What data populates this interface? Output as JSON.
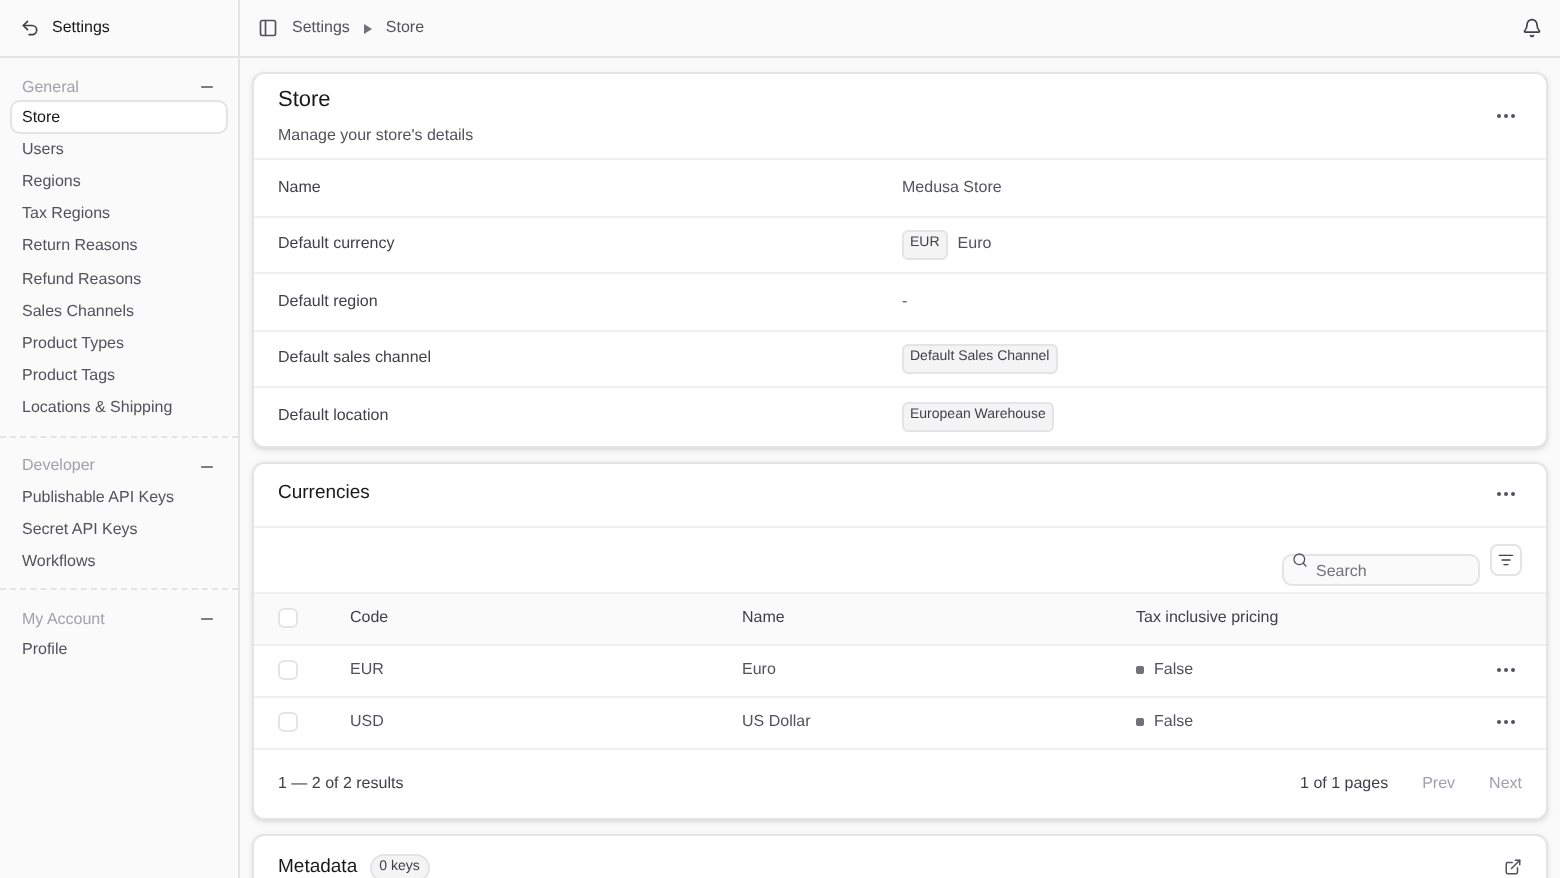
{
  "sidebar": {
    "title": "Settings",
    "sections": [
      {
        "label": "General",
        "expanded": true,
        "items": [
          {
            "label": "Store",
            "selected": true
          },
          {
            "label": "Users",
            "selected": false
          },
          {
            "label": "Regions",
            "selected": false
          },
          {
            "label": "Tax Regions",
            "selected": false
          },
          {
            "label": "Return Reasons",
            "selected": false
          },
          {
            "label": "Refund Reasons",
            "selected": false
          },
          {
            "label": "Sales Channels",
            "selected": false
          },
          {
            "label": "Product Types",
            "selected": false
          },
          {
            "label": "Product Tags",
            "selected": false
          },
          {
            "label": "Locations & Shipping",
            "selected": false
          }
        ]
      },
      {
        "label": "Developer",
        "expanded": true,
        "items": [
          {
            "label": "Publishable API Keys",
            "selected": false
          },
          {
            "label": "Secret API Keys",
            "selected": false
          },
          {
            "label": "Workflows",
            "selected": false
          }
        ]
      },
      {
        "label": "My Account",
        "expanded": true,
        "items": [
          {
            "label": "Profile",
            "selected": false
          }
        ]
      }
    ]
  },
  "breadcrumb": [
    "Settings",
    "Store"
  ],
  "store": {
    "title": "Store",
    "subtitle": "Manage your store's details",
    "rows": [
      {
        "label": "Name",
        "kind": "text",
        "value": "Medusa Store"
      },
      {
        "label": "Default currency",
        "kind": "code",
        "code": "EUR",
        "value": "Euro"
      },
      {
        "label": "Default region",
        "kind": "text",
        "value": "-"
      },
      {
        "label": "Default sales channel",
        "kind": "badge",
        "value": "Default Sales Channel"
      },
      {
        "label": "Default location",
        "kind": "badge",
        "value": "European Warehouse"
      }
    ]
  },
  "currencies": {
    "title": "Currencies",
    "search": {
      "placeholder": "Search"
    },
    "columns": [
      "Code",
      "Name",
      "Tax inclusive pricing"
    ],
    "header_checked": false,
    "rows": [
      {
        "checked": false,
        "code": "EUR",
        "name": "Euro",
        "tax": "False"
      },
      {
        "checked": false,
        "code": "USD",
        "name": "US Dollar",
        "tax": "False"
      }
    ],
    "results": "1 — 2 of 2 results",
    "pages": "1 of 1 pages",
    "prev": {
      "label": "Prev",
      "disabled": true
    },
    "next": {
      "label": "Next",
      "disabled": true
    }
  },
  "metadata": {
    "title": "Metadata",
    "count": "0 keys"
  }
}
